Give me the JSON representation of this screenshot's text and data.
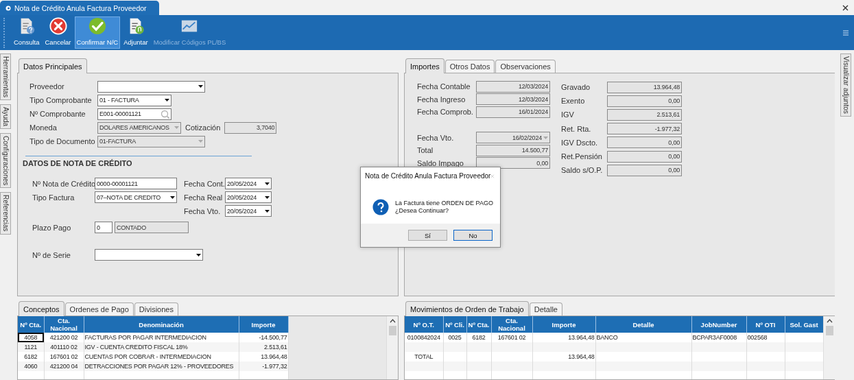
{
  "window": {
    "title": "Nota de Crédito Anula Factura Proveedor"
  },
  "toolbar": [
    {
      "label": "Consulta",
      "kind": "query",
      "selected": false,
      "disabled": false
    },
    {
      "label": "Cancelar",
      "kind": "cancel",
      "selected": false,
      "disabled": false
    },
    {
      "label": "Confirmar N/C",
      "kind": "confirm",
      "selected": true,
      "disabled": false
    },
    {
      "label": "Adjuntar",
      "kind": "attach",
      "selected": false,
      "disabled": false
    },
    {
      "label": "Modificar Códigos PL/BS",
      "kind": "chart",
      "selected": false,
      "disabled": true
    }
  ],
  "side_tabs_left": [
    {
      "label": "Herramientas"
    },
    {
      "label": "Ayuda"
    },
    {
      "label": "Configuraciones"
    },
    {
      "label": "Referencias"
    }
  ],
  "side_tabs_right": [
    {
      "label": "Visualizar adjuntos"
    }
  ],
  "datos_principales": {
    "tabs": [
      {
        "label": "Datos Principales",
        "selected": true
      }
    ],
    "fields": [
      {
        "label": "Proveedor",
        "kind": "dropdown",
        "disabled": false
      },
      {
        "label": "Tipo Comprobante",
        "kind": "dropdown",
        "value": "01 - FACTURA",
        "disabled": false
      },
      {
        "label": "Nº Comprobante",
        "kind": "search",
        "value": "E001-00001121",
        "disabled": false
      },
      {
        "label": "Moneda",
        "kind": "dropdown",
        "value": "DOLARES AMERICANOS",
        "disabled": true,
        "extra": {
          "label": "Cotización",
          "kind": "text",
          "value": "3,7040",
          "disabled": true
        }
      },
      {
        "label": "Tipo de Documento",
        "kind": "dropdown",
        "value": "01-FACTURA",
        "disabled": true
      }
    ],
    "credit_note": {
      "heading": "DATOS DE NOTA DE CRÉDITO",
      "fields": [
        {
          "label": "Nº Nota de Crédito",
          "kind": "text",
          "value": "0000-00001121",
          "disabled": false
        },
        {
          "label": "Tipo Factura",
          "kind": "dropdown",
          "value": "07–NOTA DE CREDITO",
          "disabled": false
        }
      ],
      "dates": [
        {
          "label": "Fecha Cont.",
          "kind": "dropdown",
          "value": "20/05/2024",
          "disabled": false
        },
        {
          "label": "Fecha Real",
          "kind": "dropdown",
          "value": "20/05/2024",
          "disabled": false
        },
        {
          "label": "Fecha Vto.",
          "kind": "dropdown",
          "value": "20/05/2024",
          "disabled": false
        }
      ],
      "plazo": {
        "label": "Plazo Pago",
        "fields": [
          {
            "kind": "text",
            "value": "0",
            "disabled": false
          },
          {
            "kind": "text",
            "value": "CONTADO",
            "disabled": true
          }
        ]
      },
      "serie": {
        "label": "Nº de Serie",
        "kind": "dropdown",
        "disabled": false
      }
    }
  },
  "importes": {
    "tabs": [
      {
        "label": "Importes",
        "selected": true
      },
      {
        "label": "Otros Datos",
        "selected": false
      },
      {
        "label": "Observaciones",
        "selected": false
      }
    ],
    "dates": [
      {
        "label": "Fecha Contable",
        "kind": "text",
        "value": "12/03/2024",
        "disabled": true
      },
      {
        "label": "Fecha Ingreso",
        "kind": "text",
        "value": "12/03/2024",
        "disabled": true
      },
      {
        "label": "Fecha Comprob.",
        "kind": "text",
        "value": "16/01/2024",
        "disabled": true
      }
    ],
    "amounts": [
      {
        "label": "Fecha Vto.",
        "kind": "dropdown",
        "value": "16/02/2024",
        "disabled": true
      },
      {
        "label": "Total",
        "kind": "text",
        "value": "14.500,77",
        "disabled": true
      },
      {
        "label": "Saldo Impago",
        "kind": "text",
        "value": "0,00",
        "disabled": true
      }
    ],
    "totals": [
      {
        "label": "Gravado",
        "kind": "text",
        "value": "13.964,48",
        "disabled": true
      },
      {
        "label": "Exento",
        "kind": "text",
        "value": "0,00",
        "disabled": true
      },
      {
        "label": "IGV",
        "kind": "text",
        "value": "2.513,61",
        "disabled": true
      },
      {
        "label": "Ret. Rta.",
        "kind": "text",
        "value": "-1.977,32",
        "disabled": true
      },
      {
        "label": "IGV Dscto.",
        "kind": "text",
        "value": "0,00",
        "disabled": true
      },
      {
        "label": "Ret.Pensión",
        "kind": "text",
        "value": "0,00",
        "disabled": true
      },
      {
        "label": "Saldo s/O.P.",
        "kind": "text",
        "value": "0,00",
        "disabled": true
      }
    ]
  },
  "conceptos": {
    "tabs": [
      {
        "label": "Conceptos",
        "selected": true
      },
      {
        "label": "Ordenes de Pago",
        "selected": false
      },
      {
        "label": "Divisiones",
        "selected": false
      }
    ],
    "columns": [
      "Nº Cta.",
      "Cta. Nacional",
      "Denominación",
      "Importe"
    ],
    "rows": [
      {
        "cells": [
          "4058",
          "421200 02",
          "FACTURAS POR PAGAR INTERMEDIACION",
          "-14.500,77"
        ],
        "focused": true
      },
      {
        "cells": [
          "1121",
          "401110 02",
          "IGV - CUENTA CREDITO FISCAL 18%",
          "2.513,61"
        ],
        "focused": false
      },
      {
        "cells": [
          "6182",
          "167601 02",
          "CUENTAS POR COBRAR - INTERMEDIACION",
          "13.964,48"
        ],
        "focused": false
      },
      {
        "cells": [
          "4060",
          "421200 04",
          "DETRACCIONES POR PAGAR 12% - PROVEEDORES",
          "-1.977,32"
        ],
        "focused": false
      }
    ]
  },
  "movimientos": {
    "tabs": [
      {
        "label": "Movimientos de Orden de Trabajo",
        "selected": true
      },
      {
        "label": "Detalle",
        "selected": false
      }
    ],
    "columns": [
      "Nº O.T.",
      "Nº Cli.",
      "Nº Cta.",
      "Cta. Nacional",
      "Importe",
      "Detalle",
      "JobNumber",
      "Nº OTI",
      "Sol. Gast"
    ],
    "rows": [
      {
        "kind": "data",
        "cells": [
          "0100842024",
          "0025",
          "6182",
          "167601 02",
          "13.964,48",
          "BANCO",
          "BCPAR3AF0008",
          "002568"
        ]
      },
      {
        "kind": "blank"
      },
      {
        "kind": "total",
        "label": "TOTAL",
        "importe": "13.964,48"
      }
    ]
  },
  "dialog": {
    "title": "Nota de Crédito Anula Factura Proveedor",
    "message": [
      "La Factura tiene ORDEN DE PAGO",
      "¿Desea Continuar?"
    ],
    "buttons": [
      {
        "label": "Sí",
        "selected": false
      },
      {
        "label": "No",
        "selected": true
      }
    ]
  }
}
